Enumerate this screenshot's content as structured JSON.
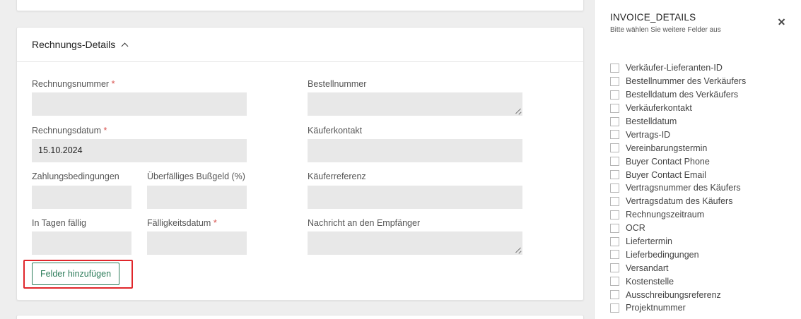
{
  "invoice_section": {
    "title": "Rechnungs-Details",
    "required_marker": "*",
    "fields": {
      "invoice_number": {
        "label": "Rechnungsnummer",
        "value": ""
      },
      "order_number": {
        "label": "Bestellnummer",
        "value": ""
      },
      "invoice_date": {
        "label": "Rechnungsdatum",
        "value": "15.10.2024"
      },
      "buyer_contact": {
        "label": "Käuferkontakt",
        "value": ""
      },
      "payment_terms": {
        "label": "Zahlungsbedingungen",
        "value": ""
      },
      "overdue_fine": {
        "label": "Überfälliges Bußgeld (%)",
        "value": ""
      },
      "buyer_reference": {
        "label": "Käuferreferenz",
        "value": ""
      },
      "due_in_days": {
        "label": "In Tagen fällig",
        "value": ""
      },
      "due_date": {
        "label": "Fälligkeitsdatum",
        "value": ""
      },
      "message_to_recipient": {
        "label": "Nachricht an den Empfänger",
        "value": ""
      }
    },
    "add_fields_label": "Felder hinzufügen"
  },
  "panel": {
    "title": "INVOICE_DETAILS",
    "subtitle": "Bitte wählen Sie weitere Felder aus",
    "options": [
      "Verkäufer-Lieferanten-ID",
      "Bestellnummer des Verkäufers",
      "Bestelldatum des Verkäufers",
      "Verkäuferkontakt",
      "Bestelldatum",
      "Vertrags-ID",
      "Vereinbarungstermin",
      "Buyer Contact Phone",
      "Buyer Contact Email",
      "Vertragsnummer des Käufers",
      "Vertragsdatum des Käufers",
      "Rechnungszeitraum",
      "OCR",
      "Liefertermin",
      "Lieferbedingungen",
      "Versandart",
      "Kostenstelle",
      "Ausschreibungsreferenz",
      "Projektnummer"
    ]
  },
  "colors": {
    "accent_green": "#2e7d5b",
    "required_red": "#d9534f",
    "highlight_red": "#e0262b",
    "field_bg": "#e8e8e8"
  },
  "icons": {
    "collapse": "chevron-up-icon",
    "close": "close-icon",
    "resize": "resize-grip-icon"
  }
}
